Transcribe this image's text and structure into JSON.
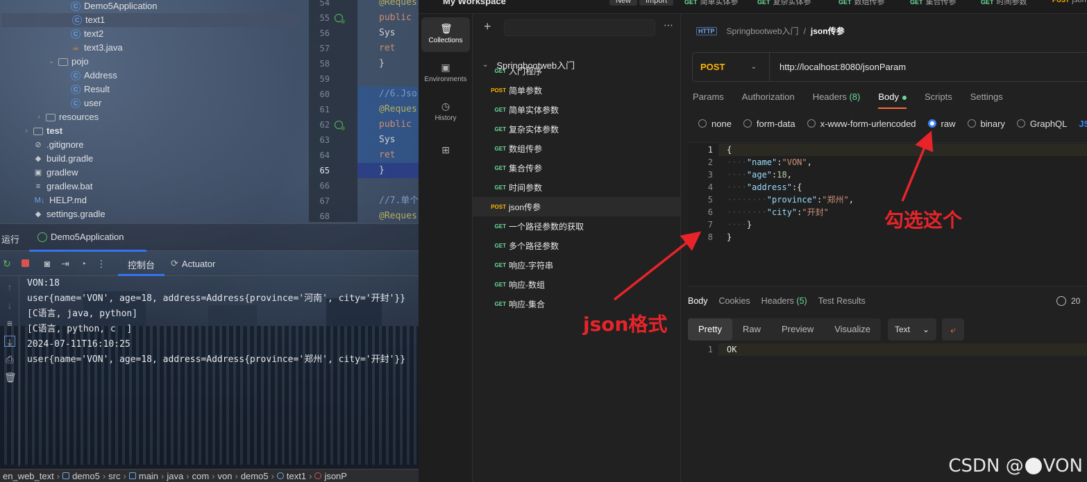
{
  "ide": {
    "tree": [
      {
        "label": "Demo5Application",
        "kind": "class",
        "indent": 3
      },
      {
        "label": "text1",
        "kind": "class",
        "indent": 3,
        "selected": true
      },
      {
        "label": "text2",
        "kind": "class",
        "indent": 3
      },
      {
        "label": "text3.java",
        "kind": "java",
        "indent": 3
      },
      {
        "label": "pojo",
        "kind": "folder",
        "indent": 2,
        "open": true
      },
      {
        "label": "Address",
        "kind": "class",
        "indent": 3
      },
      {
        "label": "Result",
        "kind": "class",
        "indent": 3
      },
      {
        "label": "user",
        "kind": "class",
        "indent": 3
      },
      {
        "label": "resources",
        "kind": "folder",
        "indent": 1,
        "open": false
      },
      {
        "label": "test",
        "kind": "folder",
        "indent": 0,
        "open": false,
        "bold": true
      },
      {
        "label": ".gitignore",
        "kind": "ignore",
        "indent": 0
      },
      {
        "label": "build.gradle",
        "kind": "file",
        "indent": 0
      },
      {
        "label": "gradlew",
        "kind": "term",
        "indent": 0
      },
      {
        "label": "gradlew.bat",
        "kind": "lines",
        "indent": 0
      },
      {
        "label": "HELP.md",
        "kind": "md",
        "indent": 0
      },
      {
        "label": "settings.gradle",
        "kind": "file",
        "indent": 0
      }
    ],
    "line_numbers": [
      "54",
      "55",
      "56",
      "57",
      "58",
      "59",
      "60",
      "61",
      "62",
      "63",
      "64",
      "65",
      "66",
      "67",
      "68"
    ],
    "code_lines": [
      {
        "text": "@Reques",
        "color": "#b3ae60"
      },
      {
        "text": "public",
        "color": "#cf8e6d"
      },
      {
        "text": "    Sys",
        "color": "#d4d4d4"
      },
      {
        "text": "    ret",
        "color": "#cf8e6d"
      },
      {
        "text": "}",
        "color": "#d4d4d4"
      },
      {
        "text": "",
        "color": "#d4d4d4"
      },
      {
        "text": "//6.Jso",
        "color": "#7a9cc7"
      },
      {
        "text": "@Reques",
        "color": "#b3ae60"
      },
      {
        "text": "public",
        "color": "#cf8e6d"
      },
      {
        "text": "    Sys",
        "color": "#d4d4d4"
      },
      {
        "text": "    ret",
        "color": "#cf8e6d"
      },
      {
        "text": "}",
        "color": "#d4d4d4"
      },
      {
        "text": "",
        "color": "#d4d4d4"
      },
      {
        "text": "//7.单个",
        "color": "#7a9cc7"
      },
      {
        "text": "@Reques",
        "color": "#b3ae60"
      }
    ],
    "run_label": "运行",
    "run_tab": "Demo5Application",
    "console_tab": "控制台",
    "actuator_tab": "Actuator",
    "console_lines": [
      "VON:18",
      "user{name='VON', age=18, address=Address{province='河南', city='开封'}}",
      "[C语言, java, python]",
      "[C语言, python, c  ]",
      "2024-07-11T16:10:25",
      "user{name='VON', age=18, address=Address{province='郑州', city='开封'}}"
    ],
    "breadcrumb": [
      "en_web_text",
      "demo5",
      "src",
      "main",
      "java",
      "com",
      "von",
      "demo5",
      "text1",
      "jsonP"
    ]
  },
  "postman": {
    "workspace": "My Workspace",
    "new_btn": "New",
    "import_btn": "Import",
    "top_tabs": [
      {
        "method": "GET",
        "label": "简单实体参"
      },
      {
        "method": "GET",
        "label": "复杂实体参"
      },
      {
        "method": "GET",
        "label": "数组传参"
      },
      {
        "method": "GET",
        "label": "集合传参"
      },
      {
        "method": "GET",
        "label": "时间参数"
      },
      {
        "method": "POST",
        "label": "json"
      }
    ],
    "nav": [
      {
        "label": "Collections",
        "icon": "collections-icon"
      },
      {
        "label": "Environments",
        "icon": "environments-icon"
      },
      {
        "label": "History",
        "icon": "history-icon"
      }
    ],
    "collection": "Springbootweb入门",
    "requests": [
      {
        "method": "GET",
        "label": "入门程序"
      },
      {
        "method": "POST",
        "label": "简单参数"
      },
      {
        "method": "GET",
        "label": "简单实体参数"
      },
      {
        "method": "GET",
        "label": "复杂实体参数"
      },
      {
        "method": "GET",
        "label": "数组传参"
      },
      {
        "method": "GET",
        "label": "集合传参"
      },
      {
        "method": "GET",
        "label": "时间参数"
      },
      {
        "method": "POST",
        "label": "json传参",
        "active": true
      },
      {
        "method": "GET",
        "label": "一个路径参数的获取"
      },
      {
        "method": "GET",
        "label": "多个路径参数"
      },
      {
        "method": "GET",
        "label": "响应-字符串"
      },
      {
        "method": "GET",
        "label": "响应-数组"
      },
      {
        "method": "GET",
        "label": "响应-集合"
      }
    ],
    "breadcrumb_collection": "Springbootweb入门",
    "breadcrumb_slash": "/",
    "breadcrumb_request": "json传参",
    "method": "POST",
    "url": "http://localhost:8080/jsonParam",
    "request_tabs": {
      "params": "Params",
      "auth": "Authorization",
      "headers": "Headers",
      "headers_count": "(8)",
      "body": "Body",
      "scripts": "Scripts",
      "settings": "Settings"
    },
    "body_options": {
      "none": "none",
      "form_data": "form-data",
      "urlencoded": "x-www-form-urlencoded",
      "raw": "raw",
      "binary": "binary",
      "graphql": "GraphQL",
      "json": "JSON"
    },
    "body_line_numbers": [
      "1",
      "2",
      "3",
      "4",
      "5",
      "6",
      "7",
      "8"
    ],
    "body_json": {
      "l1": "{",
      "name_key": "\"name\"",
      "name_val": "\"VON\"",
      "age_key": "\"age\"",
      "age_val": "18",
      "address_key": "\"address\"",
      "province_key": "\"province\"",
      "province_val": "\"郑州\"",
      "city_key": "\"city\"",
      "city_val": "\"开封\"",
      "l7": "}",
      "l8": "}"
    },
    "response_tabs": {
      "body": "Body",
      "cookies": "Cookies",
      "headers": "Headers",
      "headers_count": "(5)",
      "tests": "Test Results"
    },
    "status": "20",
    "view_tabs": [
      "Pretty",
      "Raw",
      "Preview",
      "Visualize"
    ],
    "format": "Text",
    "response_line_number": "1",
    "response_body": "OK"
  },
  "annotations": {
    "check_this": "勾选这个",
    "json_format": "json格式",
    "watermark_csdn": "CSDN @",
    "watermark_name": "VON",
    "arrow_color": "#e8242a"
  }
}
